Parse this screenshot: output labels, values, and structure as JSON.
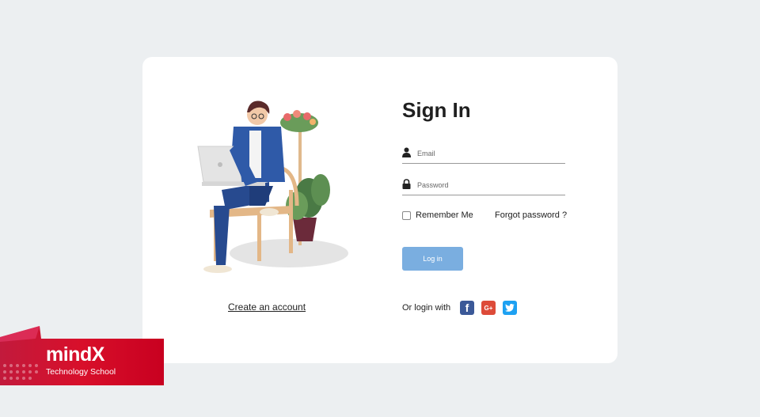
{
  "signin": {
    "title": "Sign In",
    "email_placeholder": "Email",
    "password_placeholder": "Password",
    "remember_label": "Remember Me",
    "forgot_label": "Forgot password ?",
    "login_label": "Log in",
    "or_login_label": "Or login with",
    "create_account_label": "Create an account"
  },
  "social": {
    "facebook_glyph": "f",
    "google_glyph": "G+"
  },
  "brand": {
    "name": "mindX",
    "tagline": "Technology School"
  },
  "colors": {
    "background": "#eceff1",
    "card": "#ffffff",
    "login_button": "#7aaee0",
    "facebook": "#3b5998",
    "google": "#dd4b39",
    "twitter": "#1da1f2",
    "brand_red": "#d0102a"
  }
}
